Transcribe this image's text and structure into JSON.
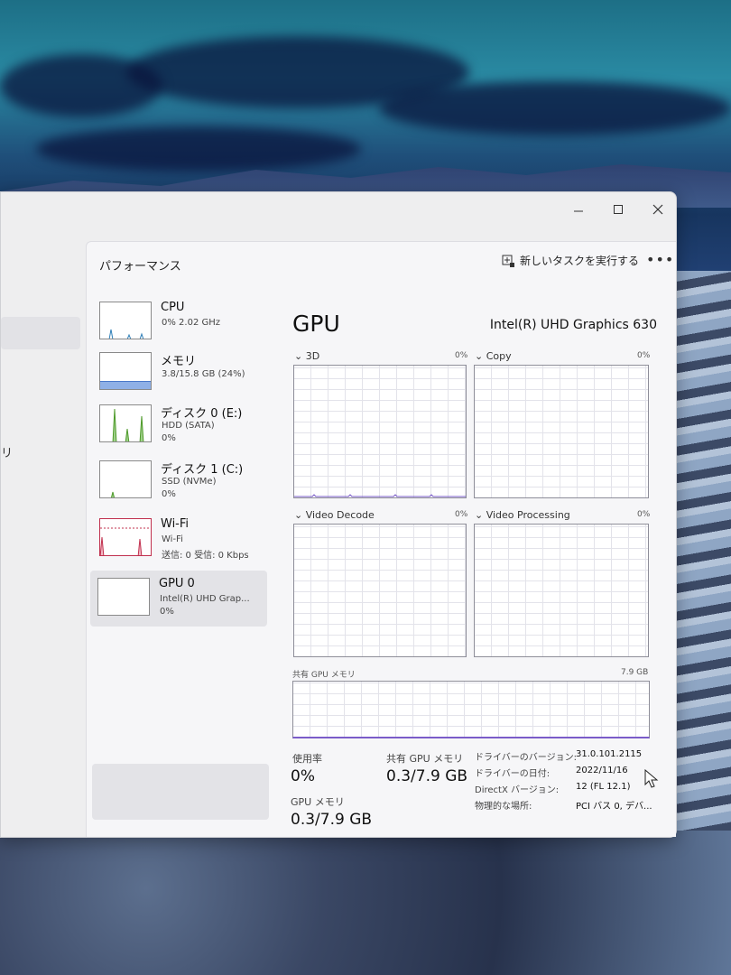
{
  "window": {
    "minimize_icon": "minimize-icon",
    "maximize_icon": "maximize-icon",
    "close_icon": "close-icon",
    "left_nav_text": "リ"
  },
  "header": {
    "title": "パフォーマンス",
    "new_task_label": "新しいタスクを実行する",
    "more_label": "•••"
  },
  "sidebar": {
    "items": [
      {
        "name": "CPU",
        "sub1": "0%  2.02 GHz",
        "sub2": ""
      },
      {
        "name": "メモリ",
        "sub1": "3.8/15.8 GB (24%)",
        "sub2": ""
      },
      {
        "name": "ディスク 0 (E:)",
        "sub1": "HDD (SATA)",
        "sub2": "0%"
      },
      {
        "name": "ディスク 1 (C:)",
        "sub1": "SSD (NVMe)",
        "sub2": "0%"
      },
      {
        "name": "Wi-Fi",
        "sub1": "Wi-Fi",
        "sub2": "送信: 0 受信: 0 Kbps"
      },
      {
        "name": "GPU 0",
        "sub1": "Intel(R) UHD Grap...",
        "sub2": "0%"
      }
    ]
  },
  "main": {
    "title": "GPU",
    "model": "Intel(R) UHD Graphics 630",
    "engines": [
      {
        "label": "3D",
        "pct": "0%"
      },
      {
        "label": "Copy",
        "pct": "0%"
      },
      {
        "label": "Video Decode",
        "pct": "0%"
      },
      {
        "label": "Video Processing",
        "pct": "0%"
      }
    ],
    "shared_mem_label": "共有 GPU メモリ",
    "shared_mem_max": "7.9 GB",
    "stats": {
      "util_label": "使用率",
      "util_value": "0%",
      "shared_label": "共有 GPU メモリ",
      "shared_value": "0.3/7.9 GB",
      "gpumem_label": "GPU メモリ",
      "gpumem_value": "0.3/7.9 GB"
    },
    "info": [
      {
        "key": "ドライバーのバージョン:",
        "value": "31.0.101.2115"
      },
      {
        "key": "ドライバーの日付:",
        "value": "2022/11/16"
      },
      {
        "key": "DirectX バージョン:",
        "value": "12 (FL 12.1)"
      },
      {
        "key": "物理的な場所:",
        "value": "PCI バス 0, デバ..."
      }
    ]
  },
  "colors": {
    "cpu": "#2e7fb8",
    "memory": "#6b8fd4",
    "disk": "#4e9a2a",
    "wifi": "#c0304e",
    "gpu": "#7b5cc9"
  }
}
